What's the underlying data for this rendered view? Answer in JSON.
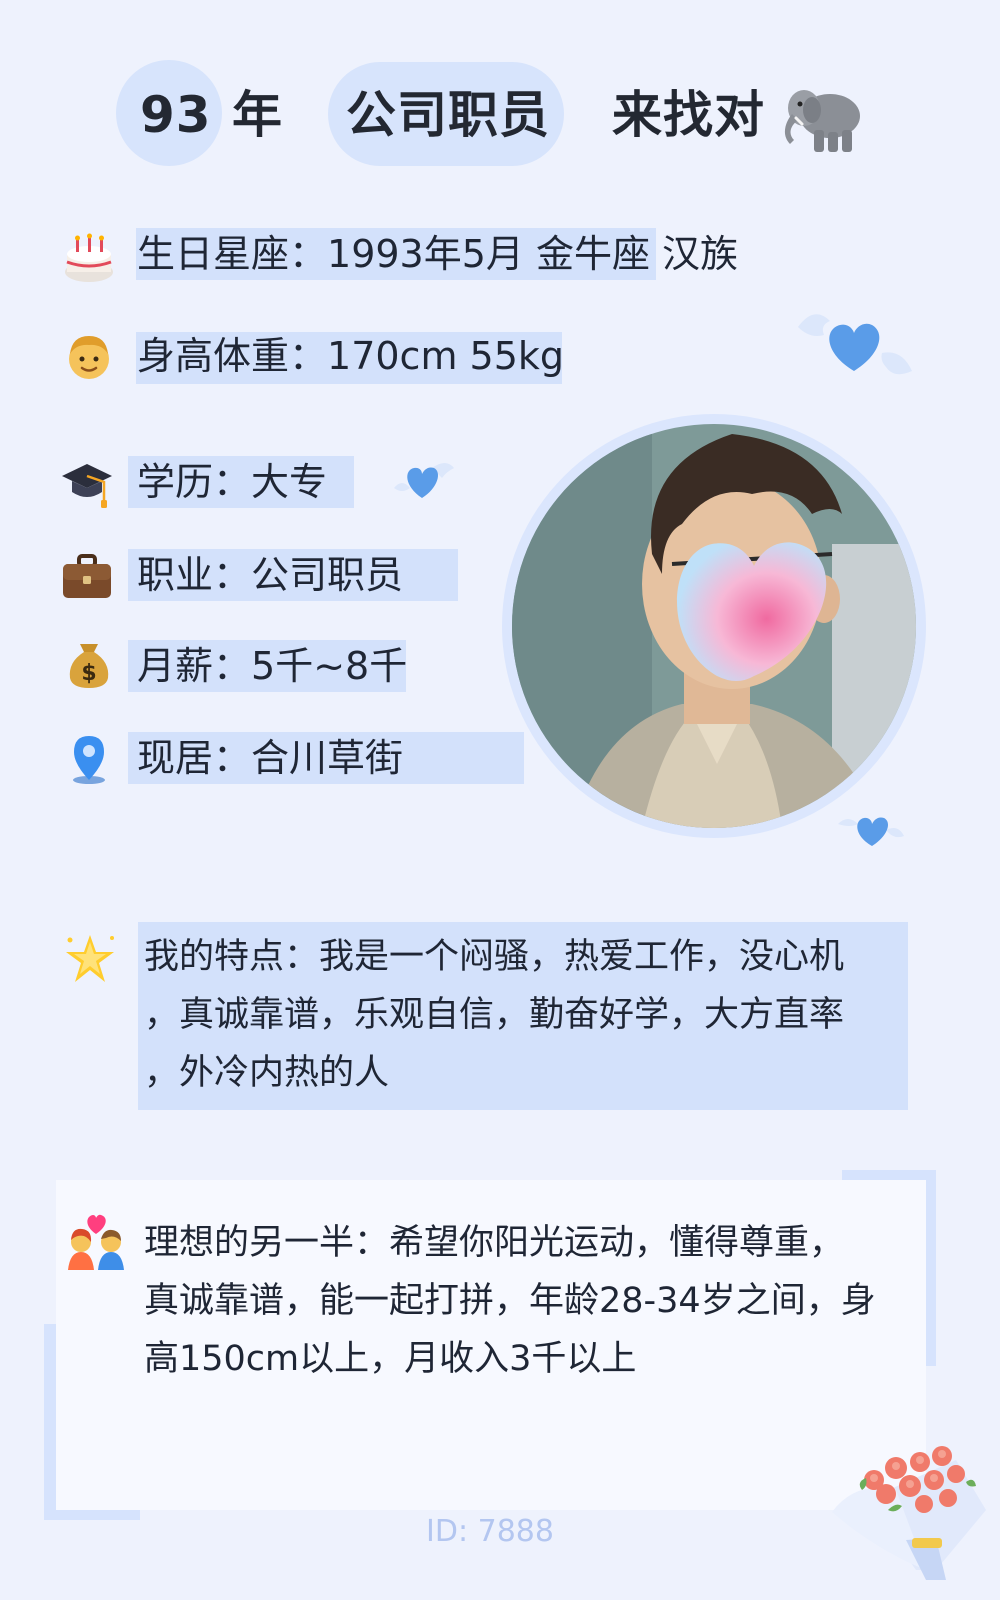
{
  "header": {
    "age_number": "93",
    "age_unit": "年",
    "occupation": "公司职员",
    "tagline": "来找对",
    "icon": "elephant-icon"
  },
  "info_rows": [
    {
      "icon": "birthday-cake-icon",
      "label": "生日星座：",
      "value": "1993年5月 金牛座 汉族"
    },
    {
      "icon": "man-face-icon",
      "label": "身高体重：",
      "value": "170cm 55kg"
    },
    {
      "icon": "graduation-cap-icon",
      "label": "学历：",
      "value": "大专"
    },
    {
      "icon": "briefcase-icon",
      "label": "职业：",
      "value": "公司职员"
    },
    {
      "icon": "money-bag-icon",
      "label": "月薪：",
      "value": "5千~8千"
    },
    {
      "icon": "location-pin-icon",
      "label": "现居：",
      "value": "合川草街"
    }
  ],
  "features": {
    "icon": "star-icon",
    "line1": "我的特点：我是一个闷骚，热爱工作，没心机",
    "line2": "，真诚靠谱，乐观自信，勤奋好学，大方直率",
    "line3": "，外冷内热的人"
  },
  "ideal_partner": {
    "icon": "couple-heart-icon",
    "line1": "理想的另一半：希望你阳光运动，懂得尊重，",
    "line2": "真诚靠谱，能一起打拼，年龄28-34岁之间，身",
    "line3": "高150cm以上，月收入3千以上"
  },
  "footer": {
    "id_text": "ID: 7888"
  },
  "colors": {
    "background": "#eef2fd",
    "highlight": "#d3e1fb",
    "heart": "#5a9ce8",
    "id_text": "#b3c6f0"
  }
}
